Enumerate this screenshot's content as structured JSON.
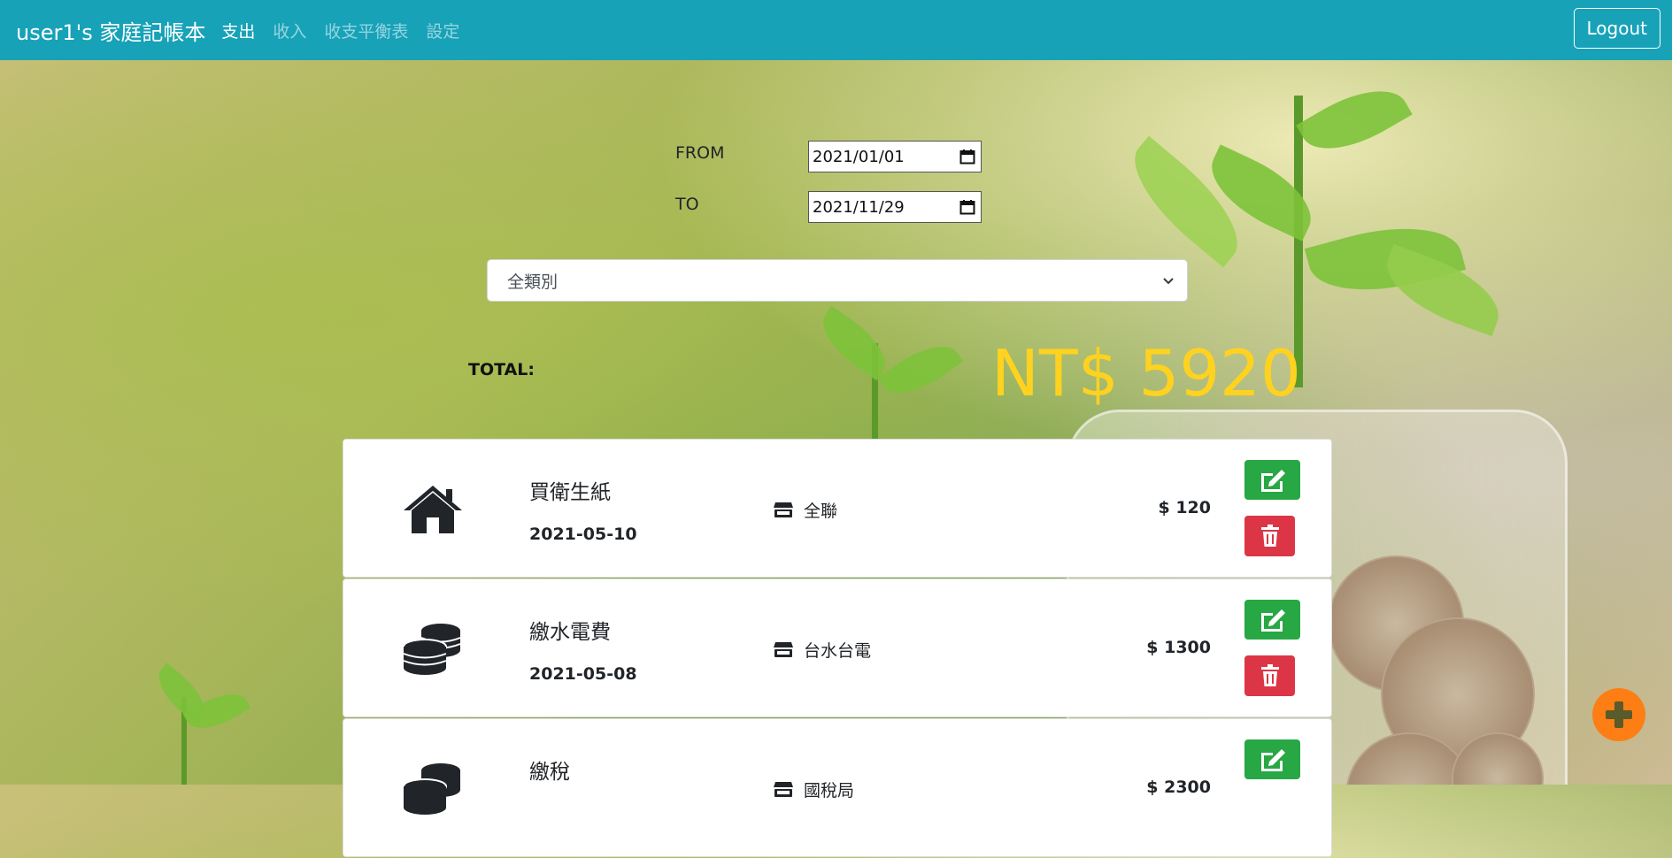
{
  "navbar": {
    "brand": "user1's 家庭記帳本",
    "links": [
      "支出",
      "收入",
      "收支平衡表",
      "設定"
    ],
    "logout_label": "Logout"
  },
  "filters": {
    "from_label": "FROM",
    "from_value": "2021/01/01",
    "to_label": "TO",
    "to_value": "2021/11/29",
    "category_selected": "全類別"
  },
  "summary": {
    "total_label": "TOTAL:",
    "total_amount": "NT$ 5920"
  },
  "records": [
    {
      "title": "買衛生紙",
      "date": "2021-05-10",
      "store": "全聯",
      "amount": "$ 120",
      "icon": "home-icon"
    },
    {
      "title": "繳水電費",
      "date": "2021-05-08",
      "store": "台水台電",
      "amount": "$ 1300",
      "icon": "coins-icon"
    },
    {
      "title": "繳稅",
      "date": "",
      "store": "國稅局",
      "amount": "$ 2300",
      "icon": "coins-icon"
    }
  ],
  "colors": {
    "navbar": "#17a2b8",
    "total": "#ffd21f",
    "edit": "#28a745",
    "delete": "#dc3545",
    "add": "#fd7e14"
  }
}
